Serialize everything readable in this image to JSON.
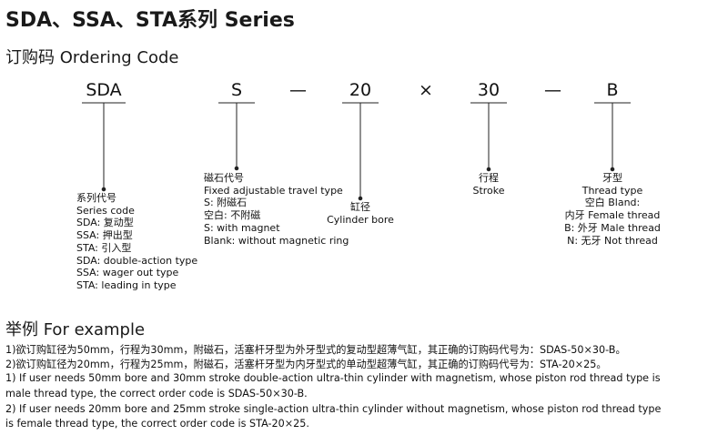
{
  "title": "SDA、SSA、STA系列 Series",
  "ordering_heading": "订购码 Ordering Code",
  "code_parts": {
    "series": "SDA",
    "magnet": "S",
    "dash1": "—",
    "bore": "20",
    "times": "×",
    "stroke": "30",
    "dash2": "—",
    "thread": "B"
  },
  "series_desc": [
    "系列代号",
    "Series code",
    "SDA: 复动型",
    "SSA: 押出型",
    "STA:  引入型",
    "SDA:  double-action type",
    "SSA:  wager out type",
    "STA:  leading in type"
  ],
  "magnet_desc": [
    "磁石代号",
    "Fixed adjustable travel type",
    "S: 附磁石",
    "空白: 不附磁",
    "S: with magnet",
    "Blank: without magnetic ring"
  ],
  "bore_desc": [
    "缸径",
    "Cylinder bore"
  ],
  "stroke_desc": [
    "行程",
    "Stroke"
  ],
  "thread_desc": [
    "牙型",
    "Thread type",
    "空白 Bland:",
    "内牙 Female thread",
    "B: 外牙 Male thread",
    "N: 无牙 Not thread"
  ],
  "example_heading": "举例 For example",
  "examples": [
    "1)欲订购缸径为50mm，行程为30mm，附磁石，活塞杆牙型为外牙型式的复动型超薄气缸，其正确的订购码代号为：SDAS-50×30-B。",
    "2)欲订购缸径为20mm，行程为25mm，附磁石，活塞杆牙型为内牙型式的单动型超薄气缸，其正确的订购码代号为：STA-20×25。",
    "1) If user needs 50mm bore and 30mm stroke double-action ultra-thin cylinder with magnetism, whose piston rod thread type is",
    "male thread type, the correct order code is SDAS-50×30-B.",
    "2) If user needs 20mm bore and 25mm stroke single-action ultra-thin cylinder without magnetism, whose piston rod thread type",
    "is female thread type, the correct order code is STA-20×25."
  ]
}
